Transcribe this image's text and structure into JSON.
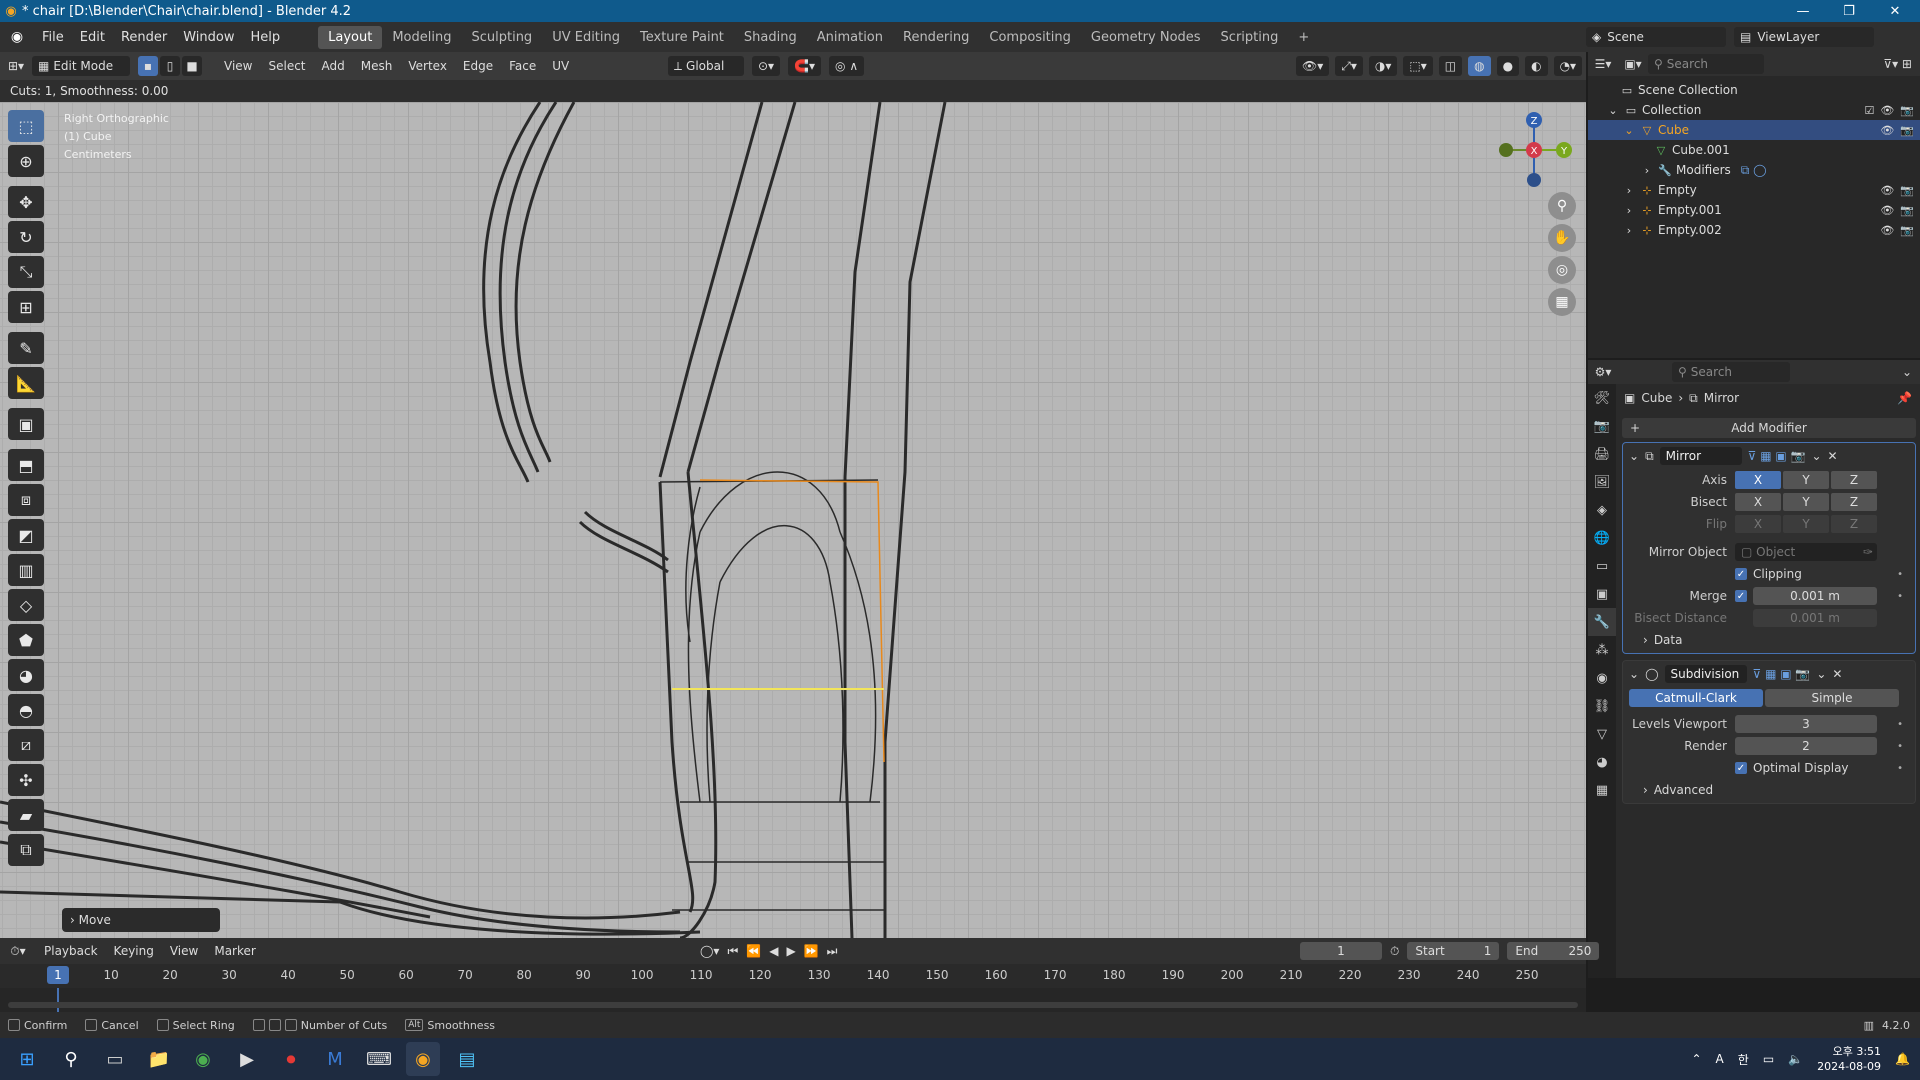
{
  "window": {
    "title": "* chair [D:\\Blender\\Chair\\chair.blend] - Blender 4.2",
    "min": "—",
    "max": "❐",
    "close": "✕"
  },
  "menu": [
    "File",
    "Edit",
    "Render",
    "Window",
    "Help"
  ],
  "workspaces": [
    "Layout",
    "Modeling",
    "Sculpting",
    "UV Editing",
    "Texture Paint",
    "Shading",
    "Animation",
    "Rendering",
    "Compositing",
    "Geometry Nodes",
    "Scripting"
  ],
  "active_workspace": "Layout",
  "scene": {
    "label": "Scene",
    "viewlayer": "ViewLayer"
  },
  "viewport_header": {
    "mode": "Edit Mode",
    "menus": [
      "View",
      "Select",
      "Add",
      "Mesh",
      "Vertex",
      "Edge",
      "Face",
      "UV"
    ],
    "orientation": "Global"
  },
  "operator_status": "Cuts: 1, Smoothness: 0.00",
  "viewport_info": {
    "line1": "Right Orthographic",
    "line2": "(1) Cube",
    "line3": "Centimeters"
  },
  "gizmo": {
    "z": "Z",
    "y": "Y",
    "x": "X"
  },
  "move_panel": "Move",
  "outliner": {
    "search_placeholder": "Search",
    "rows": [
      {
        "label": "Scene Collection"
      },
      {
        "label": "Collection"
      },
      {
        "label": "Cube"
      },
      {
        "label": "Cube.001"
      },
      {
        "label": "Modifiers"
      },
      {
        "label": "Empty"
      },
      {
        "label": "Empty.001"
      },
      {
        "label": "Empty.002"
      }
    ]
  },
  "properties": {
    "search_placeholder": "Search",
    "breadcrumb": {
      "object": "Cube",
      "modifier": "Mirror"
    },
    "add_modifier": "Add Modifier",
    "mirror": {
      "name": "Mirror",
      "axis_label": "Axis",
      "bisect_label": "Bisect",
      "flip_label": "Flip",
      "x": "X",
      "y": "Y",
      "z": "Z",
      "mirror_object_label": "Mirror Object",
      "mirror_object_placeholder": "Object",
      "clipping_label": "Clipping",
      "merge_label": "Merge",
      "merge_value": "0.001 m",
      "bisect_distance_label": "Bisect Distance",
      "bisect_distance_value": "0.001 m",
      "data_label": "Data"
    },
    "subdivision": {
      "name": "Subdivision",
      "catmull": "Catmull-Clark",
      "simple": "Simple",
      "levels_viewport_label": "Levels Viewport",
      "levels_viewport_value": "3",
      "render_label": "Render",
      "render_value": "2",
      "optimal_label": "Optimal Display",
      "advanced_label": "Advanced"
    }
  },
  "timeline": {
    "menus": [
      "Playback",
      "Keying",
      "View",
      "Marker"
    ],
    "current_frame": "1",
    "start_label": "Start",
    "start_value": "1",
    "end_label": "End",
    "end_value": "250",
    "ticks": [
      "10",
      "20",
      "30",
      "40",
      "50",
      "60",
      "70",
      "80",
      "90",
      "100",
      "110",
      "120",
      "130",
      "140",
      "150",
      "160",
      "170",
      "180",
      "190",
      "200",
      "210",
      "220",
      "230",
      "240",
      "250"
    ]
  },
  "status_bar": {
    "confirm": "Confirm",
    "cancel": "Cancel",
    "select_ring": "Select Ring",
    "number_of_cuts": "Number of Cuts",
    "alt": "Alt",
    "smoothness": "Smoothness",
    "version": "4.2.0"
  },
  "taskbar": {
    "ime1": "A",
    "ime2": "한",
    "time": "오후 3:51",
    "date": "2024-08-09"
  },
  "colors": {
    "accent": "#4772b3",
    "titlebar": "#0f5a8c",
    "edge_selected": "#e8891c",
    "loop_cut": "#f2e55a"
  }
}
